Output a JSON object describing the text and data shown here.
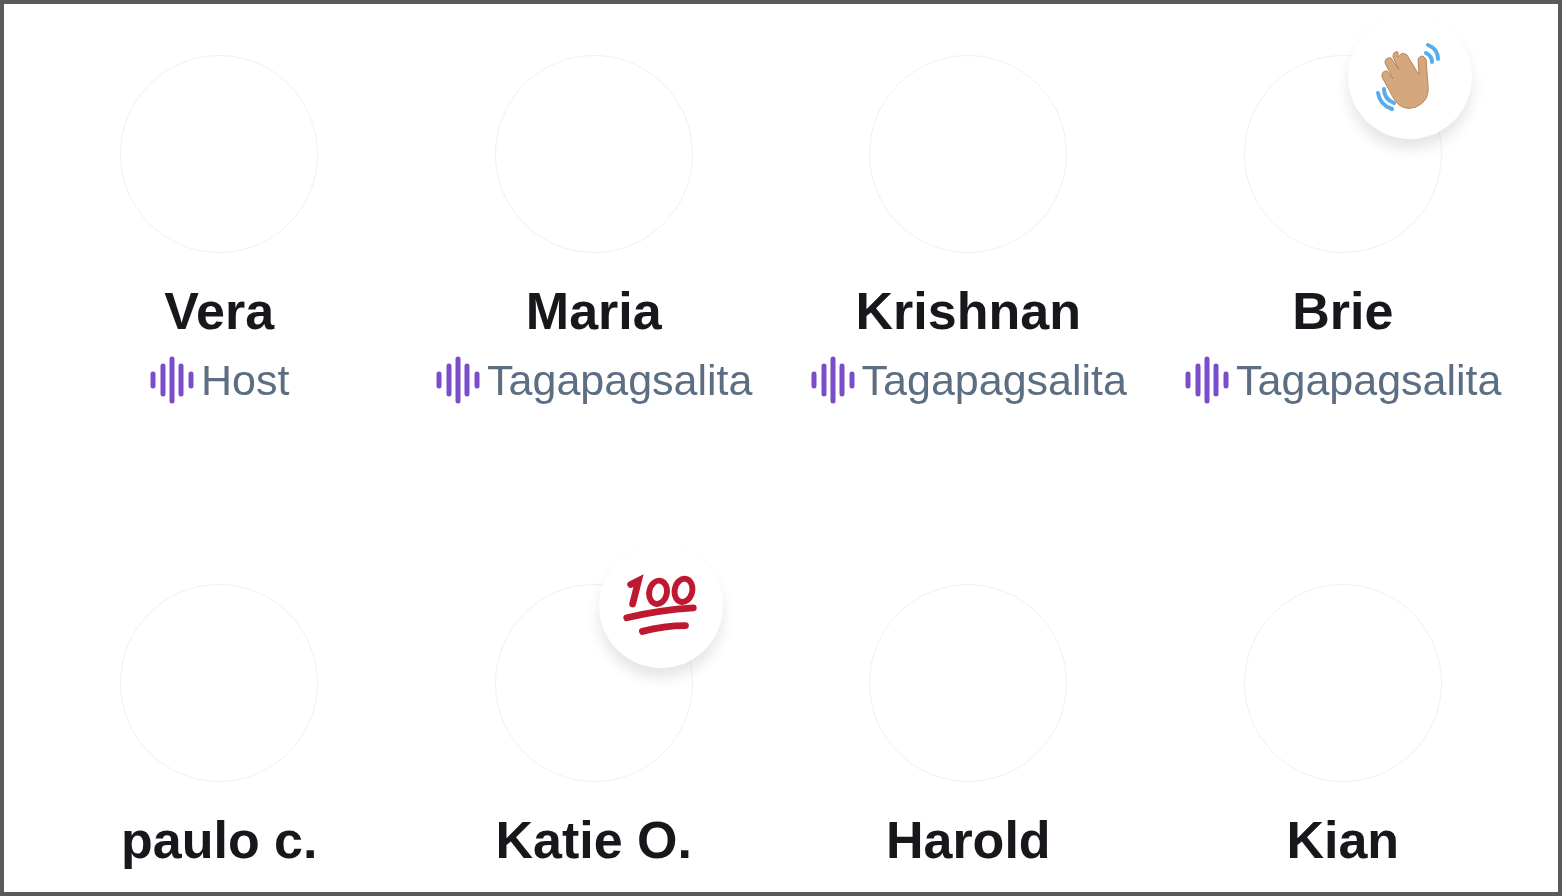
{
  "participants": [
    {
      "name": "Vera",
      "role": "Host"
    },
    {
      "name": "Maria",
      "role": "Tagapagsalita"
    },
    {
      "name": "Krishnan",
      "role": "Tagapagsalita"
    },
    {
      "name": "Brie",
      "role": "Tagapagsalita",
      "reaction": {
        "kind": "wave"
      }
    },
    {
      "name": "paulo c."
    },
    {
      "name": "Katie O.",
      "reaction": {
        "kind": "hundred"
      }
    },
    {
      "name": "Harold"
    },
    {
      "name": "Kian"
    }
  ]
}
